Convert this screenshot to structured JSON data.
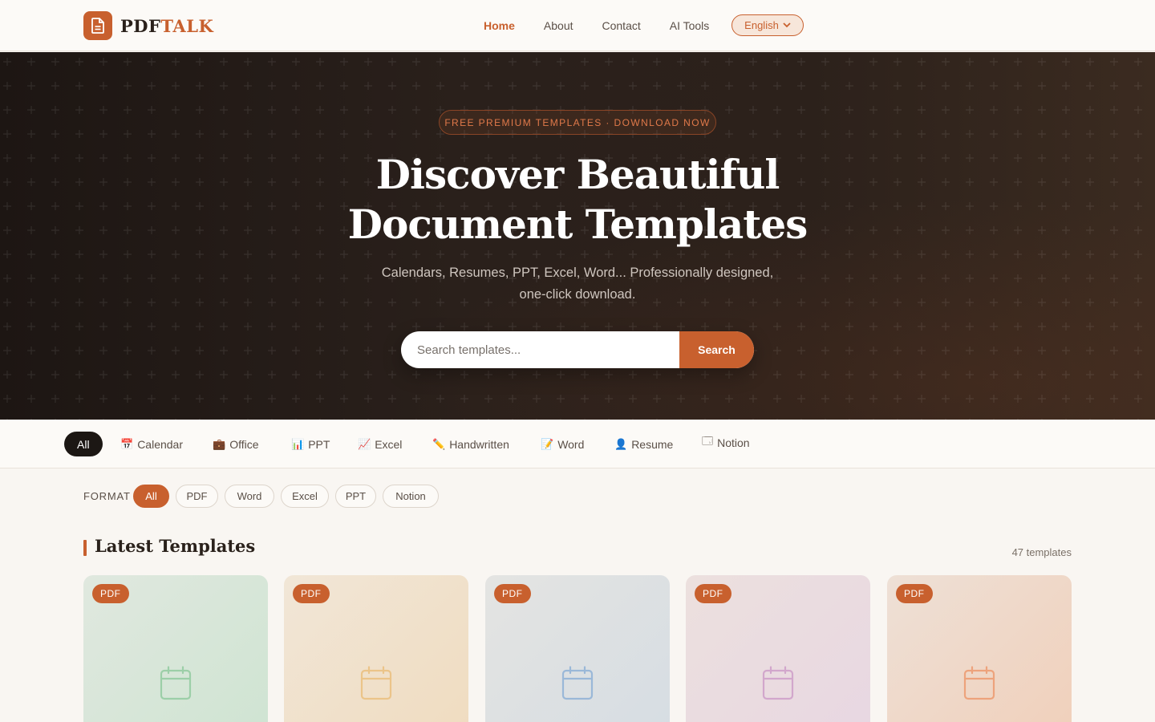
{
  "nav": {
    "logo_a": "PDF",
    "logo_b": "TALK",
    "links": [
      "Home",
      "About",
      "Contact",
      "AI Tools"
    ],
    "active_link": "Home",
    "language": "English"
  },
  "hero": {
    "badge": "FREE PREMIUM TEMPLATES · DOWNLOAD NOW",
    "title_line1": "Discover Beautiful",
    "title_line2": "Document Templates",
    "subtitle_line1": "Calendars, Resumes, PPT, Excel, Word... Professionally designed,",
    "subtitle_line2": "one-click download.",
    "search_placeholder": "Search templates...",
    "search_button": "Search"
  },
  "categories": [
    {
      "label": "All",
      "icon": "",
      "active": true
    },
    {
      "label": "Calendar",
      "icon": "📅"
    },
    {
      "label": "Office",
      "icon": "💼"
    },
    {
      "label": "PPT",
      "icon": "📊"
    },
    {
      "label": "Excel",
      "icon": "📈"
    },
    {
      "label": "Handwritten",
      "icon": "✏️"
    },
    {
      "label": "Word",
      "icon": "📝"
    },
    {
      "label": "Resume",
      "icon": "👤"
    },
    {
      "label": "Notion",
      "icon": "🗔"
    }
  ],
  "format": {
    "label": "FORMAT",
    "options": [
      "All",
      "PDF",
      "Word",
      "Excel",
      "PPT",
      "Notion"
    ],
    "active": "All"
  },
  "section": {
    "title": "Latest Templates",
    "count": "47 templates"
  },
  "cards": [
    {
      "tag": "PDF",
      "icon": "calendar-icon",
      "color": "#9ccfa8"
    },
    {
      "tag": "PDF",
      "icon": "calendar-icon",
      "color": "#ebc489"
    },
    {
      "tag": "PDF",
      "icon": "calendar-icon",
      "color": "#9ab8d8"
    },
    {
      "tag": "PDF",
      "icon": "calendar-icon",
      "color": "#d2a7cc"
    },
    {
      "tag": "PDF",
      "icon": "calendar-icon",
      "color": "#eda37c"
    }
  ],
  "colors": {
    "accent": "#c8602e",
    "dark": "#1c1714"
  }
}
